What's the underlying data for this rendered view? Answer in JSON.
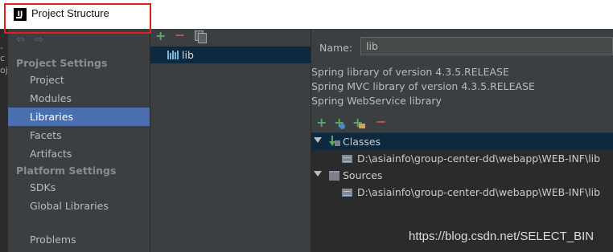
{
  "window": {
    "title": "Project Structure",
    "app_icon_letters": "IJ"
  },
  "outer_fragments": {
    "a": "-c",
    "b": "oj"
  },
  "sidebar": {
    "nav_arrows": "⇦ ⇨",
    "sections": [
      {
        "title": "Project Settings",
        "items": [
          "Project",
          "Modules",
          "Libraries",
          "Facets",
          "Artifacts"
        ]
      },
      {
        "title": "Platform Settings",
        "items": [
          "SDKs",
          "Global Libraries"
        ]
      }
    ],
    "bottom_item": "Problems",
    "selected": "Libraries"
  },
  "libraries_list": {
    "items": [
      "lib"
    ],
    "selected": "lib"
  },
  "detail": {
    "name_label": "Name:",
    "name_value": "lib",
    "descriptions": [
      "Spring library of version 4.3.5.RELEASE",
      "Spring MVC library of version 4.3.5.RELEASE",
      "Spring WebService library"
    ],
    "tree": {
      "classes_label": "Classes",
      "classes_path": "D:\\asiainfo\\group-center-dd\\webapp\\WEB-INF\\lib",
      "sources_label": "Sources",
      "sources_path": "D:\\asiainfo\\group-center-dd\\webapp\\WEB-INF\\lib"
    }
  },
  "watermark": "https://blog.csdn.net/SELECT_BIN",
  "colors": {
    "selection": "#4b6eaf",
    "add": "#59a869",
    "remove": "#c75450",
    "highlight_box": "#e0201b"
  }
}
